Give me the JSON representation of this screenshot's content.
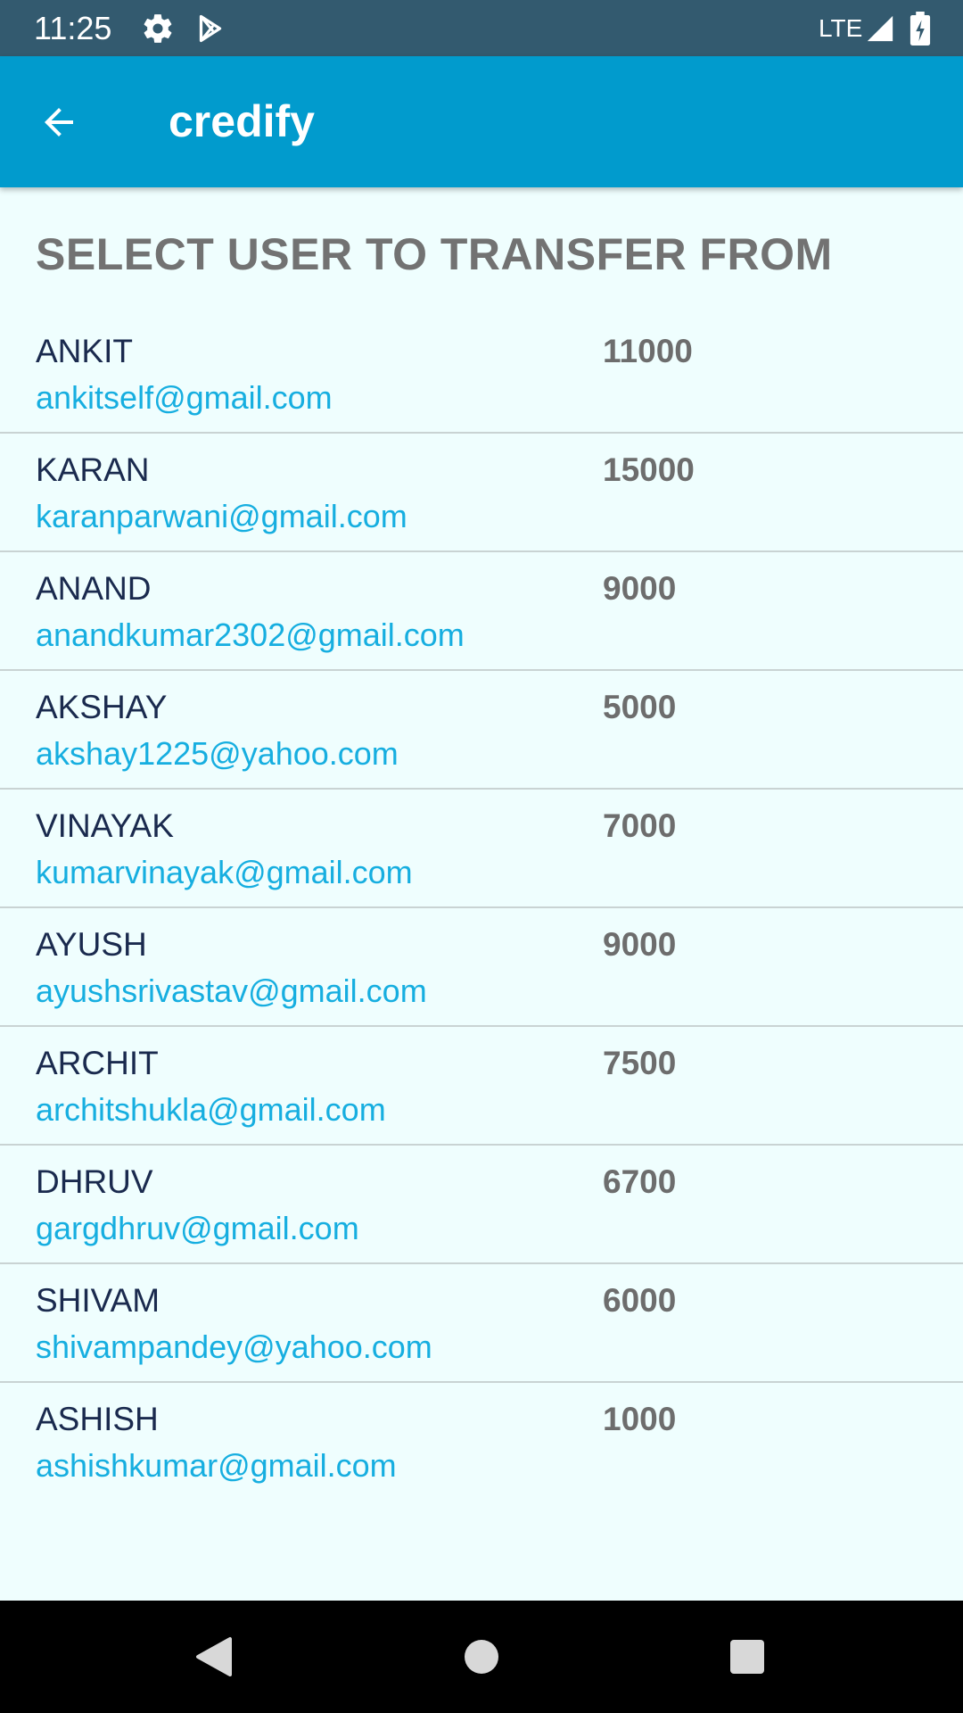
{
  "status_bar": {
    "time": "11:25",
    "network": "LTE",
    "icons": [
      "gear-icon",
      "play-store-icon",
      "signal-icon",
      "battery-charging-icon"
    ]
  },
  "app_bar": {
    "title": "credify",
    "back_icon": "arrow-back-icon",
    "background": "#019bcd"
  },
  "main": {
    "heading": "SELECT USER TO TRANSFER FROM",
    "users": [
      {
        "name": "ANKIT",
        "email": "ankitself@gmail.com",
        "balance": "11000"
      },
      {
        "name": "KARAN",
        "email": "karanparwani@gmail.com",
        "balance": "15000"
      },
      {
        "name": "ANAND",
        "email": "anandkumar2302@gmail.com",
        "balance": "9000"
      },
      {
        "name": "AKSHAY",
        "email": "akshay1225@yahoo.com",
        "balance": "5000"
      },
      {
        "name": "VINAYAK",
        "email": "kumarvinayak@gmail.com",
        "balance": "7000"
      },
      {
        "name": "AYUSH",
        "email": "ayushsrivastav@gmail.com",
        "balance": "9000"
      },
      {
        "name": "ARCHIT",
        "email": "architshukla@gmail.com",
        "balance": "7500"
      },
      {
        "name": "DHRUV",
        "email": "gargdhruv@gmail.com",
        "balance": "6700"
      },
      {
        "name": "SHIVAM",
        "email": "shivampandey@yahoo.com",
        "balance": "6000"
      },
      {
        "name": "ASHISH",
        "email": "ashishkumar@gmail.com",
        "balance": "1000"
      }
    ]
  },
  "nav_bar": {
    "icons": [
      "back-triangle-icon",
      "home-circle-icon",
      "recents-square-icon"
    ]
  },
  "colors": {
    "status_bar": "#335a6f",
    "app_bar": "#019bcd",
    "background": "#effefe",
    "name_text": "#1a2a4e",
    "email_text": "#16aee0",
    "balance_text": "#6d6d6d",
    "heading_text": "#727272"
  }
}
